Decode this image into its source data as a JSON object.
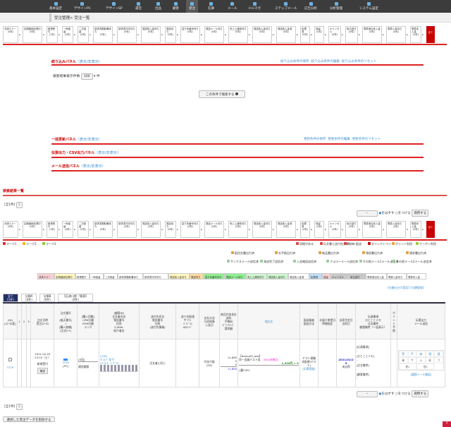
{
  "nav": [
    "基本設定",
    "デザインPC",
    "デザインSP",
    "運営",
    "出品",
    "顧客",
    "受注",
    "在庫",
    "メール",
    "メルマガ",
    "ステップメール",
    "広告分析",
    "分析管理",
    "システム設定"
  ],
  "nav_active": 6,
  "breadcrumb": "受注管理> 受注一覧",
  "statuses": [
    [
      "決済エラー",
      "(0件)"
    ],
    [
      "定期継続処理中",
      "(0件)"
    ],
    [
      "新規受付",
      "(1件)"
    ],
    [
      "一時保留",
      "(0件)"
    ],
    [
      "二次保留",
      "(0件)"
    ],
    [
      "請求書郵取備待ち",
      "(0件)"
    ],
    [
      "請求書印字待ち",
      "(0件)"
    ],
    [
      "発送前入金待ち",
      "(0件)"
    ],
    [
      "発送待ち",
      "(0件)"
    ],
    [
      "送り状番号待ち",
      "(0件)"
    ],
    [
      "発送メール待ち",
      "(0件)"
    ],
    [
      "売上上通常待ち",
      "(0件)"
    ],
    [
      "発送後入金待ち",
      "(0件)"
    ],
    [
      "発送後入金済",
      "(0件)"
    ],
    [
      "処理済",
      "(0件)"
    ],
    [
      "保留",
      "(0件)"
    ],
    [
      "キャンセル",
      "(0件)"
    ],
    [
      "後日送付",
      "(0件)"
    ],
    [
      "電算追加未入金",
      "(0件)"
    ],
    [
      "電算入金待ち",
      "(0件)"
    ],
    [
      "電算未入金",
      "(0件)"
    ]
  ],
  "status_all": "全て",
  "filter": {
    "title": "絞り込みパネル",
    "toggle": "（表示/非表示）",
    "links": [
      "絞り込み条件の保存",
      "絞り込み条件の編集",
      "絞り込み条件のリセット"
    ],
    "count_label": "検索結果表示件数",
    "count_value": "100",
    "count_unit": "件",
    "search_button": "この条件で検索する"
  },
  "bulk": {
    "title": "一括更新パネル",
    "toggle": "（表示/非表示）",
    "links": [
      "更新条件の保存",
      "更新条件の編集",
      "更新条件のリセット"
    ]
  },
  "csv": {
    "title": "伝票出力・CSV出力パネル",
    "toggle": "（表示/非表示）"
  },
  "mail": {
    "title": "メール送信パネル",
    "toggle": "（表示/非表示）"
  },
  "results": {
    "title": "検索結果一覧",
    "total": "[全1件]",
    "page": "1",
    "select": "--",
    "radio1": "をはずす",
    "radio2": "をつける",
    "apply": "適用する"
  },
  "marks": [
    "マーク1",
    "マーク2",
    "マーク3"
  ],
  "marks_colors": [
    "#e22",
    "#f0b400",
    "#8c3"
  ],
  "icon_legend1": [
    "同梱がある",
    "伝文書と送付先が異なる",
    "ギフト配送",
    "ダイレクトペイ",
    "ポイント利用",
    "クーポン利用"
  ],
  "icon_legend2": [
    "配信先書出力済",
    "お手紙出力済",
    "納品書出力済",
    "領収書出力済",
    "請求書出力済"
  ],
  "icon_legend3": [
    "サンクスメール送信済",
    "発送完了送信済",
    "入金確認送信済",
    "フォローメール送信済",
    "その他メール1メール送信済",
    "その他メール2メール送信済"
  ],
  "color_legend": [
    [
      "決済エラー",
      "#f8d0d4"
    ],
    [
      "定期継続処理中",
      "#fff8c0"
    ],
    [
      "新規受付",
      "#fff"
    ],
    [
      "一時保留",
      "#fff"
    ],
    [
      "二次保留",
      "#fff"
    ],
    [
      "請求書郵取備待ち",
      "#fff"
    ],
    [
      "請求書印字待ち",
      "#fff"
    ],
    [
      "発送前入金待ち",
      "#fff8c0"
    ],
    [
      "発送待ち",
      "#fcd9a0"
    ],
    [
      "送り状番号待ち",
      "#90ee90"
    ],
    [
      "発送メール待ち",
      "#90ee90"
    ],
    [
      "売上上通常待ち",
      "#cff5cf"
    ],
    [
      "発送後入金待ち",
      "#cff5cf"
    ],
    [
      "発送後入金済",
      "#fff"
    ],
    [
      "処理済",
      "#bcdcf8"
    ],
    [
      "保留",
      "#f8d0d4"
    ],
    [
      "キャンセル",
      "#c8c8c8"
    ],
    [
      "後日送付",
      "#c8c8c8"
    ],
    [
      "電算追加未入金",
      "#fff"
    ],
    [
      "電算入金待ち",
      "#fff"
    ],
    [
      "電算未入金",
      "#fff"
    ]
  ],
  "class_links": [
    "[分類仕分け設定]",
    "[分類登録]"
  ],
  "tabs": [
    [
      "全て",
      "(1件)"
    ],
    [
      "分類A",
      "(0件)"
    ],
    [
      "分類B",
      "(0件)"
    ],
    [
      "【石津川野『電表】",
      "(0件)"
    ]
  ],
  "headers": [
    "(ID)\n[ｽﾃｰﾀｽ変]",
    "1",
    "2",
    "3",
    "注文日時\n受注ｽﾃｰﾀｽ",
    "注文番号\n/\n(楽天番号)\n/\n[購入依頼]\n(注文ﾙｰﾄ)",
    "[購入回数]\nCPM分類\nRFM分類\nランク",
    "(顧客ID)\n注文者氏名\n電話番号\n住所\nE-MAIL\n紹介者名",
    "送付先氏名\n電話番号\n住所\n(送付先情報)",
    "送り先配達\nギフト\nｺﾞﾐｼﾞﾙｼ\nADｺｰﾄﾞ",
    "支払方法\n与信結果\n入金日",
    "商品代金合計\n送料\n手数料\nﾎﾟｲﾝﾄﾗｰﾄﾞ\n請求額",
    "商品名",
    "配送業者\n配送方法",
    "お届け希望日\n時間指定",
    "出荷予定日\n出荷日",
    "伝達事項\nひとことメモ\n注文備考\n顧客備考（一括表示）",
    "ポイント\n手続",
    "伝票出力\nメール送信"
  ],
  "row": {
    "id": "3729",
    "date": "2021-02-20\n23:19（土）",
    "status": "新規受付",
    "status_btn": "確認",
    "order_no": "3729",
    "route": "[PC]",
    "count": "[5回]",
    "rank": "優良顧客",
    "customer": "(376)\nテスト 花子\n(テスト ハナコ)",
    "address": "注文者に同じ",
    "payment": "代金引換\n(OK)",
    "amounts": [
      "11,880",
      "0",
      "0",
      "11,880"
    ],
    "product": "【demo09_test】\n同一会員テスト用",
    "product_tag": "(SKU未確定)",
    "product_price": "1,320円 × 9",
    "product_sub": "(通P:0P)",
    "carrier": "ヤマト運輸\n宅配便(ヤマト)",
    "carrier_link": "[伝票登録]",
    "ship": "2021/02/25",
    "ship_sub": "未出荷",
    "memo": [
      "[伝達事項]",
      "[ひとことメモ]",
      "[注文備考]",
      "[顧客備考]"
    ],
    "mail_cells": [
      "受",
      "手",
      "納",
      "領",
      "請",
      "確",
      "サ",
      "入",
      "発",
      "フ",
      "他1",
      "他2"
    ],
    "mail_link": "[履歴メール確認]"
  },
  "delete_button": "選択した受注データを削除する"
}
